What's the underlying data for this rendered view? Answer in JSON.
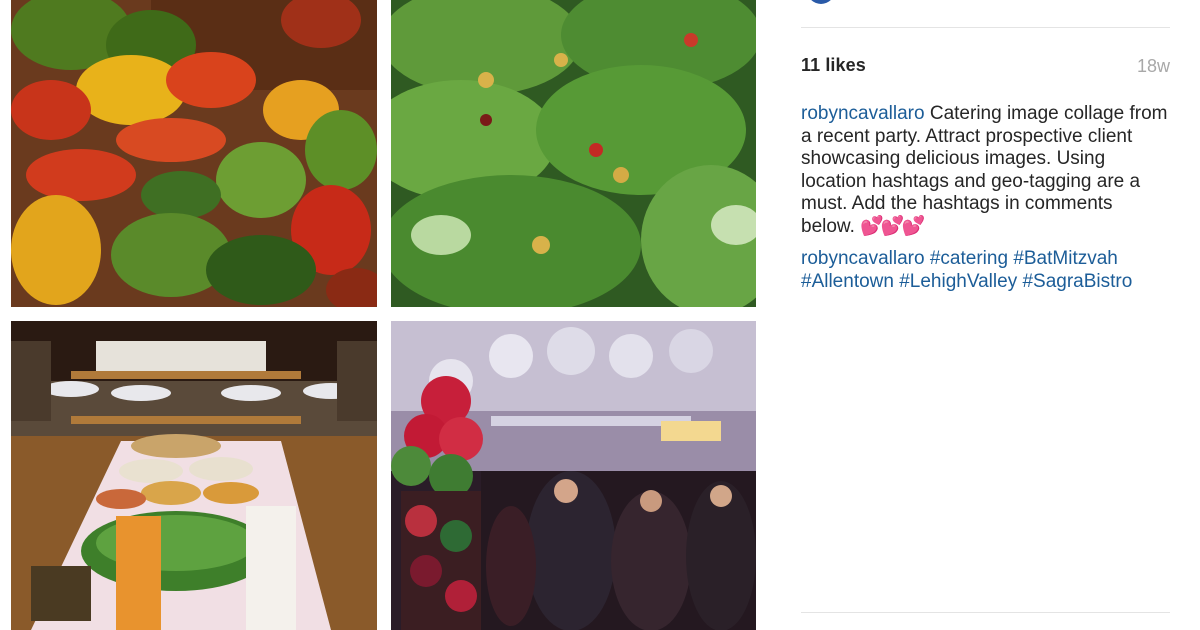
{
  "post": {
    "likes_text": "11 likes",
    "age": "18w",
    "username": "robyncavallaro",
    "caption": "Catering image collage from a recent party. Attract prospective client showcasing delicious images. Using location hashtags and geo-tagging are a must. Add the hashtags in comments below.",
    "caption_emoji": "💕💕💕",
    "comment_username": "robyncavallaro",
    "hashtags": [
      "#catering",
      "#BatMitzvah",
      "#Allentown",
      "#LehighValley",
      "#SagraBistro"
    ]
  },
  "colors": {
    "link": "#1c5d98",
    "text": "#262626",
    "muted": "#a8a8a8"
  }
}
